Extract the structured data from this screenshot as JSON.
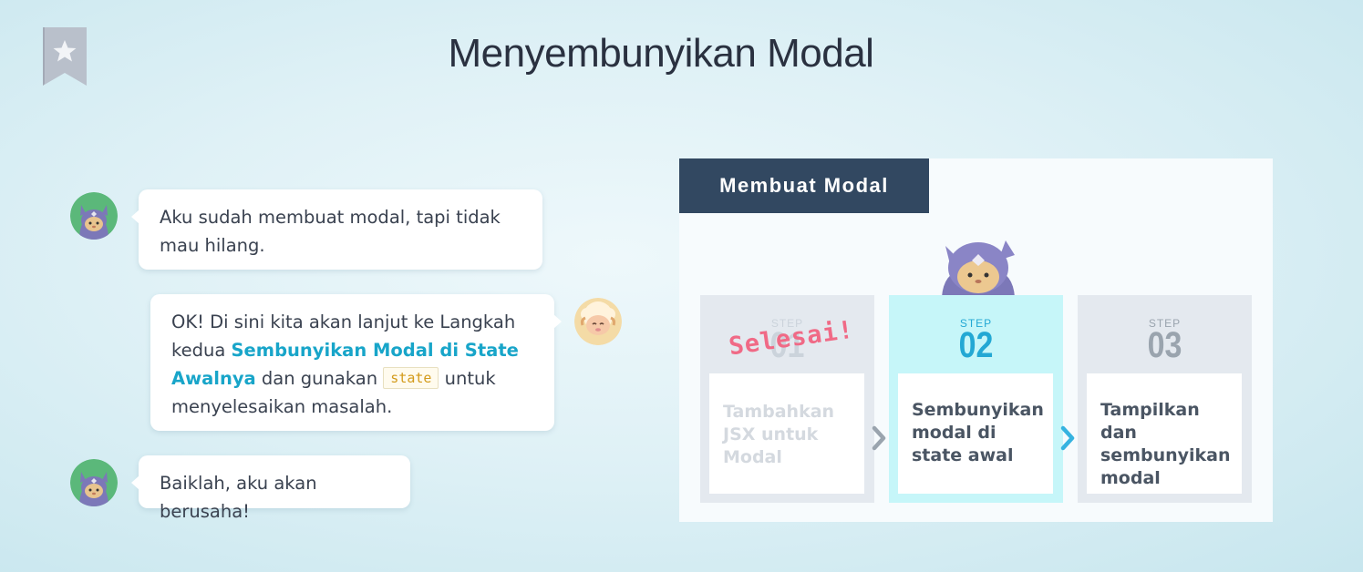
{
  "page": {
    "title": "Menyembunyikan Modal",
    "bookmark_icon": "star-bookmark-icon"
  },
  "chat": {
    "messages": [
      {
        "speaker": "ninja-cat",
        "side": "left",
        "text": "Aku sudah membuat modal, tapi tidak mau hilang."
      },
      {
        "speaker": "sheep",
        "side": "right",
        "text_before": "OK! Di sini kita akan lanjut ke Langkah kedua ",
        "highlight": "Sembunyikan Modal di State Awalnya",
        "text_middle": " dan gunakan ",
        "code": "state",
        "text_after": " untuk menyelesaikan masalah."
      },
      {
        "speaker": "ninja-cat",
        "side": "left",
        "text": "Baiklah, aku akan berusaha!"
      }
    ]
  },
  "panel": {
    "header": "Membuat Modal",
    "done_stamp": "Selesai!",
    "steps": [
      {
        "label": "STEP",
        "number": "01",
        "text": "Tambahkan JSX untuk Modal",
        "status": "done"
      },
      {
        "label": "STEP",
        "number": "02",
        "text": "Sembunyikan modal di state awal",
        "status": "active"
      },
      {
        "label": "STEP",
        "number": "03",
        "text": "Tampilkan dan sembunyikan modal",
        "status": "todo"
      }
    ]
  },
  "colors": {
    "header_bg": "#324861",
    "active_step_bg": "#c6f6f9",
    "accent": "#18a5c9",
    "stamp": "#f06a86"
  }
}
